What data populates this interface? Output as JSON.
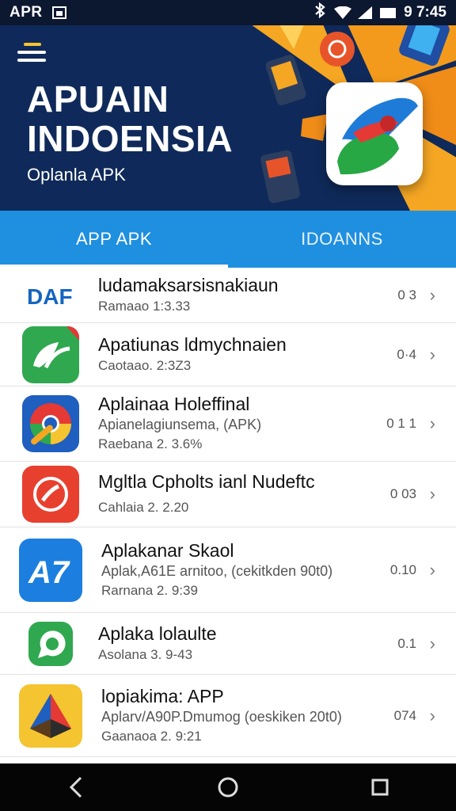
{
  "status_bar": {
    "carrier": "APR",
    "time": "9 7:45"
  },
  "header": {
    "title_line1": "APUAIN",
    "title_line2": "INDOENSIA",
    "subtitle": "Oplanla APK",
    "accent_color": "#f5a623",
    "bg_color": "#0f2a5a"
  },
  "tabs": [
    {
      "label": "APP  APK",
      "active": true
    },
    {
      "label": "IDOANNS",
      "active": false
    }
  ],
  "apps": [
    {
      "name": "ludamaksarsisnakiaun",
      "desc": "",
      "meta": "Ramaao 1:3.33",
      "rank": "0 3",
      "icon": "daf-logo-icon"
    },
    {
      "name": "Apatiunas ldmychnaien",
      "desc": "",
      "meta": "Caotaao. 2:3Z3",
      "rank": "0·4",
      "icon": "green-leaf-icon"
    },
    {
      "name": "Aplainaa Holeffinal",
      "desc": "Apianelagiunsema, (APK)",
      "meta": "Raebana 2. 3.6%",
      "rank": "0 1 1",
      "icon": "chrome-like-icon"
    },
    {
      "name": "Mgltla Cpholts ianl Nudeftc",
      "desc": "",
      "meta": "Cahlaia 2. 2.20",
      "rank": "0 03",
      "icon": "red-brush-icon"
    },
    {
      "name": "Aplakanar Skaol",
      "desc": "Aplak,A61E arnitoo, (cekitkden 90t0)",
      "meta": "Rarnana 2. 9:39",
      "rank": "0.10",
      "icon": "translate-a7-icon"
    },
    {
      "name": "Aplaka lolaulte",
      "desc": "",
      "meta": "Asolana 3. 9-43",
      "rank": "0.1",
      "icon": "green-chat-icon"
    },
    {
      "name": "lopiakima: APP",
      "desc": "Aplarv/A90P.Dmumog (oeskiken 20t0)",
      "meta": "Gaanaoa 2. 9:21",
      "rank": "074",
      "icon": "yellow-prism-icon"
    }
  ],
  "nav": {
    "back": "back-icon",
    "home": "home-icon",
    "recents": "recents-icon"
  }
}
